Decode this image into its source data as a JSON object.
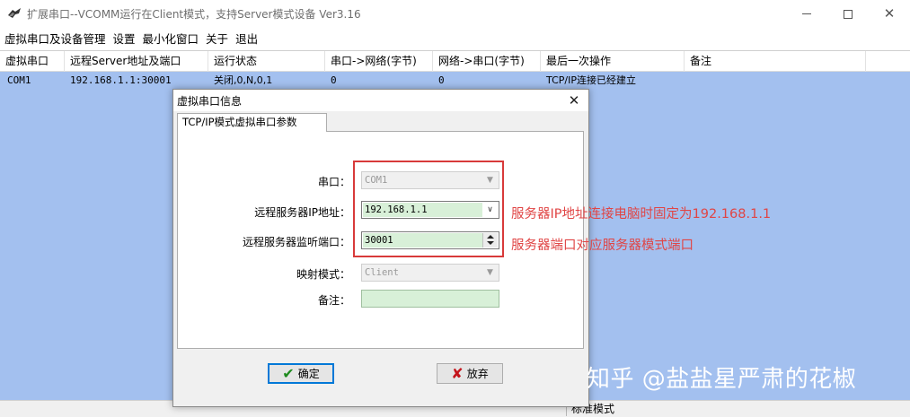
{
  "window": {
    "title": "扩展串口--VCOMM运行在Client模式，支持Server模式设备  Ver3.16",
    "icon": "app-icon"
  },
  "menu": [
    "虚拟串口及设备管理",
    "设置",
    "最小化窗口",
    "关于",
    "退出"
  ],
  "list": {
    "columns": [
      "虚拟串口",
      "远程Server地址及端口",
      "运行状态",
      "串口->网络(字节)",
      "网络->串口(字节)",
      "最后一次操作",
      "备注"
    ],
    "rows": [
      [
        "COM1",
        "192.168.1.1:30001",
        "关闭,0,N,0,1",
        "0",
        "0",
        "TCP/IP连接已经建立",
        ""
      ]
    ]
  },
  "statusbar": {
    "mode": "标准模式"
  },
  "dialog": {
    "title": "虚拟串口信息",
    "tab": "TCP/IP模式虚拟串口参数",
    "fields": {
      "port_label": "串口：",
      "port_value": "COM1",
      "ip_label": "远程服务器IP地址：",
      "ip_value": "192.168.1.1",
      "listen_port_label": "远程服务器监听端口：",
      "listen_port_value": "30001",
      "mode_label": "映射模式：",
      "mode_value": "Client",
      "note_label": "备注：",
      "note_value": ""
    },
    "ok_label": "确定",
    "cancel_label": "放弃"
  },
  "annotations": {
    "ip_note": "服务器IP地址连接电脑时固定为192.168.1.1",
    "port_note": "服务器端口对应服务器模式端口"
  },
  "watermark": "知乎 @盐盐星严肃的花椒",
  "colors": {
    "list_background": "#a3c0ef",
    "annotation_red": "#e04545",
    "note_field_green": "#d8f0d8",
    "ok_border": "#0078d7"
  }
}
